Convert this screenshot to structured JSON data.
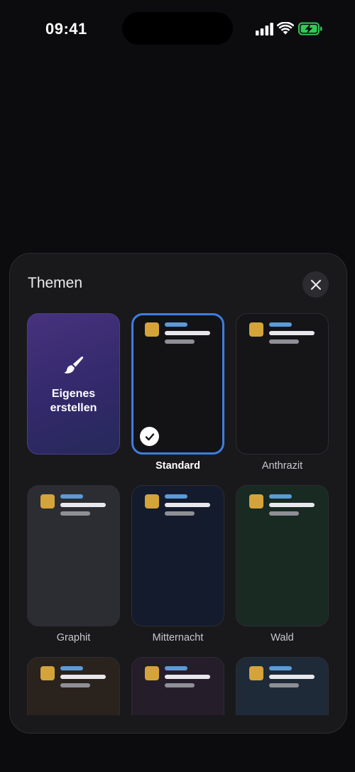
{
  "status_bar": {
    "time": "09:41",
    "icons": [
      "signal-bars-icon",
      "wifi-icon",
      "battery-charging-icon"
    ],
    "battery_color": "#33c759"
  },
  "sheet": {
    "title": "Themen",
    "close_icon": "close-icon",
    "custom_tile": {
      "icon": "paintbrush-icon",
      "label_line1": "Eigenes",
      "label_line2": "erstellen"
    },
    "themes": [
      {
        "name": "Standard",
        "selected": true
      },
      {
        "name": "Anthrazit",
        "selected": false
      },
      {
        "name": "Graphit",
        "selected": false
      },
      {
        "name": "Mitternacht",
        "selected": false
      },
      {
        "name": "Wald",
        "selected": false
      }
    ],
    "accent_color": "#3f7de0"
  }
}
